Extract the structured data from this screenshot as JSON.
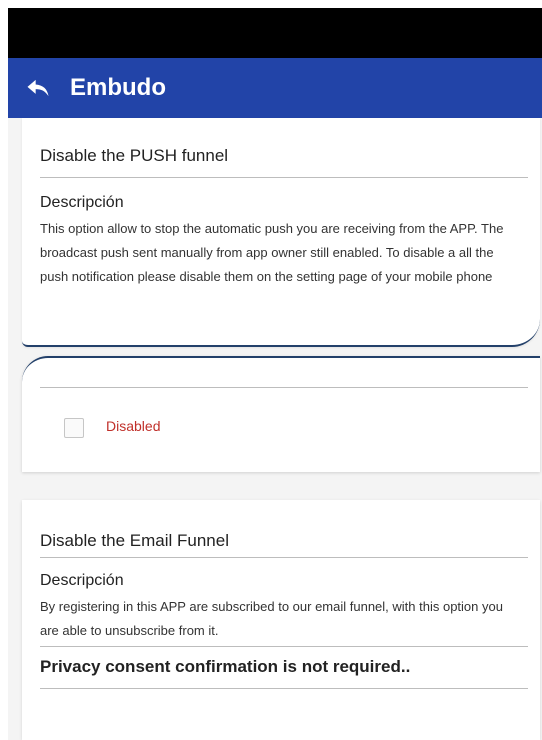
{
  "app_bar": {
    "title": "Embudo",
    "back_icon": "back-arrow-icon",
    "color": "#2244a8"
  },
  "push_card": {
    "title": "Disable the PUSH funnel",
    "description_heading": "Descripción",
    "description": "This option allow to stop the automatic push you are receiving from the APP. The broadcast push sent manually from app owner still enabled. To disable a all the push notification please disable them on the setting page of your mobile phone",
    "checkbox_label": "Disabled",
    "checkbox_checked": false,
    "label_color": "#c0302a"
  },
  "email_card": {
    "title": "Disable the Email Funnel",
    "description_heading": "Descripción",
    "description": "By registering in this APP are subscribed to our email funnel, with this option you are able to unsubscribe from it.",
    "privacy_text": "Privacy consent confirmation is not required.."
  }
}
